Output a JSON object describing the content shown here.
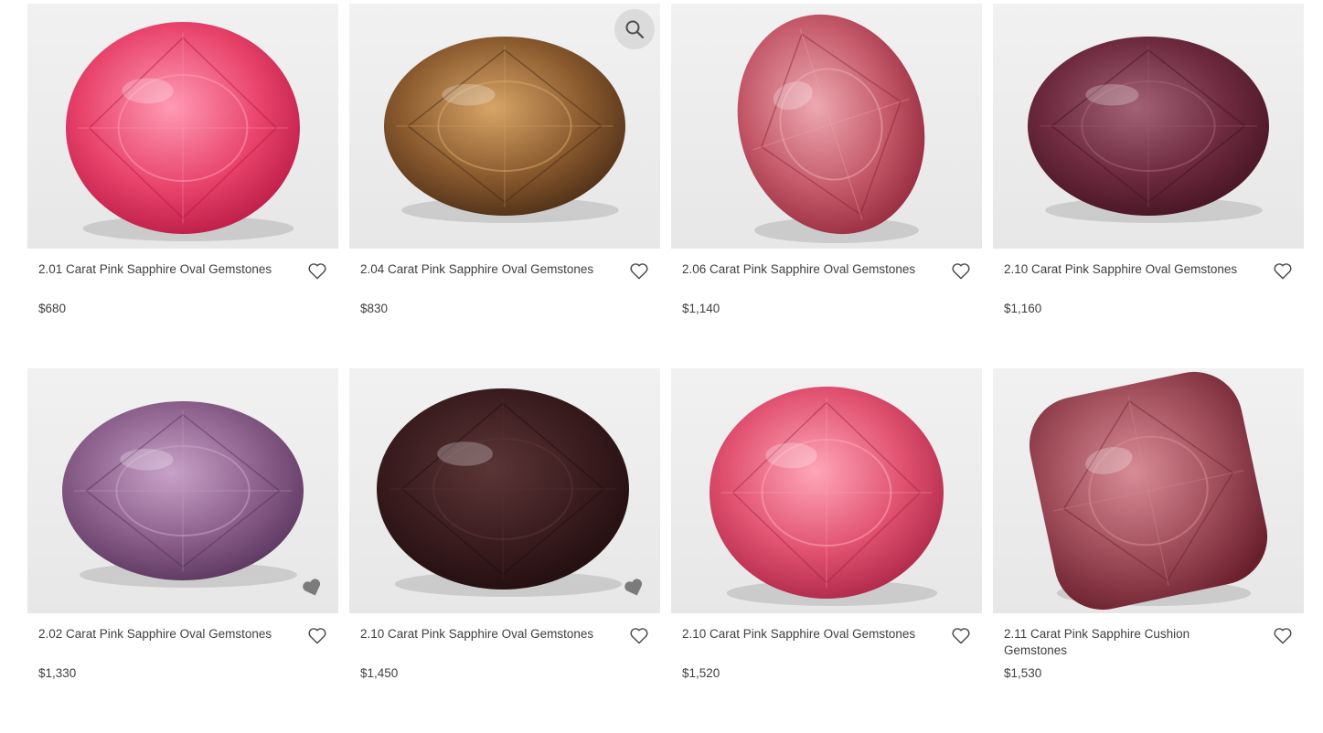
{
  "products": [
    {
      "title": "2.01 Carat Pink Sapphire Oval Gemstones",
      "price": "$680",
      "color": "#e8436b",
      "light": "#ff9ab4",
      "dark": "#b0123d",
      "shape": "round"
    },
    {
      "title": "2.04 Carat Pink Sapphire Oval Gemstones",
      "price": "$830",
      "color": "#8a5a2e",
      "light": "#d7a567",
      "dark": "#3e2412",
      "shape": "oval-wide"
    },
    {
      "title": "2.06 Carat Pink Sapphire Oval Gemstones",
      "price": "$1,140",
      "color": "#c4596a",
      "light": "#eda9b1",
      "dark": "#8a1f32",
      "shape": "oval-tilt"
    },
    {
      "title": "2.10 Carat Pink Sapphire Oval Gemstones",
      "price": "$1,160",
      "color": "#6d2a3e",
      "light": "#a26276",
      "dark": "#3c0f1d",
      "shape": "oval-wide"
    },
    {
      "title": "2.02 Carat Pink Sapphire Oval Gemstones",
      "price": "$1,330",
      "color": "#8a5f8a",
      "light": "#c8a2c8",
      "dark": "#4e2c52",
      "shape": "oval-wide"
    },
    {
      "title": "2.10 Carat Pink Sapphire Oval Gemstones",
      "price": "$1,450",
      "color": "#3a1c1e",
      "light": "#5b3536",
      "dark": "#1c0a0b",
      "shape": "oval-big"
    },
    {
      "title": "2.10 Carat Pink Sapphire Oval Gemstones",
      "price": "$1,520",
      "color": "#e0506f",
      "light": "#ffa6b8",
      "dark": "#a01d3f",
      "shape": "round"
    },
    {
      "title": "2.11 Carat Pink Sapphire Cushion Gemstones",
      "price": "$1,530",
      "color": "#a24f5c",
      "light": "#d78c96",
      "dark": "#6a1f2d",
      "shape": "cushion"
    }
  ],
  "icons": {
    "zoom": "magnifier-icon",
    "wishlist": "heart-outline-icon",
    "liked": "heart-filled-icon"
  }
}
